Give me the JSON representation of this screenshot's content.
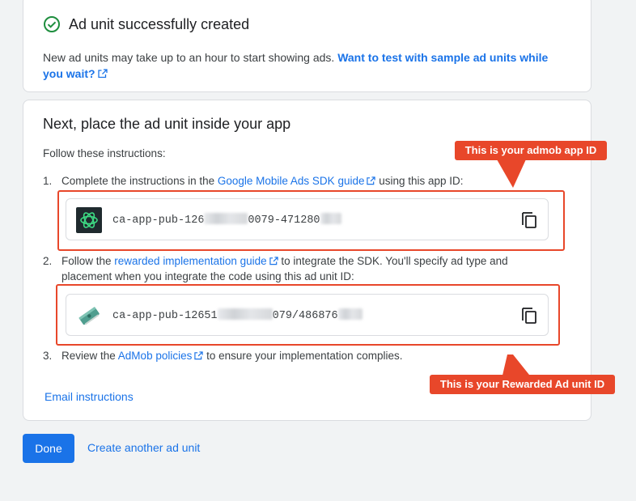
{
  "success_card": {
    "title": "Ad unit successfully created",
    "description": "New ad units may take up to an hour to start showing ads.",
    "sample_link": "Want to test with sample ad units while you wait?"
  },
  "place_card": {
    "heading": "Next, place the ad unit inside your app",
    "instructions_label": "Follow these instructions:",
    "steps": [
      {
        "num": "1.",
        "before": "Complete the instructions in the ",
        "link": "Google Mobile Ads SDK guide",
        "after": " using this app ID:"
      },
      {
        "num": "2.",
        "before": "Follow the ",
        "link": "rewarded implementation guide",
        "after": " to integrate the SDK. You'll specify ad type and placement when you integrate the code using this ad unit ID:"
      },
      {
        "num": "3.",
        "before": "Review the ",
        "link": "AdMob policies",
        "after": " to ensure your implementation complies."
      }
    ],
    "app_id": {
      "prefix": "ca-app-pub-126",
      "middle": "0079-471280",
      "icon": "app-logo-icon"
    },
    "ad_unit_id": {
      "prefix": "ca-app-pub-12651",
      "middle": "079/486876",
      "icon": "rewarded-ad-icon"
    },
    "email_link": "Email instructions"
  },
  "actions": {
    "done": "Done",
    "create_another": "Create another ad unit"
  },
  "annotations": {
    "app_id_callout": "This is your admob app ID",
    "ad_unit_callout": "This is your Rewarded Ad unit ID"
  },
  "colors": {
    "accent": "#1a73e8",
    "success": "#1e8e3e",
    "annotation": "#e8472a"
  }
}
